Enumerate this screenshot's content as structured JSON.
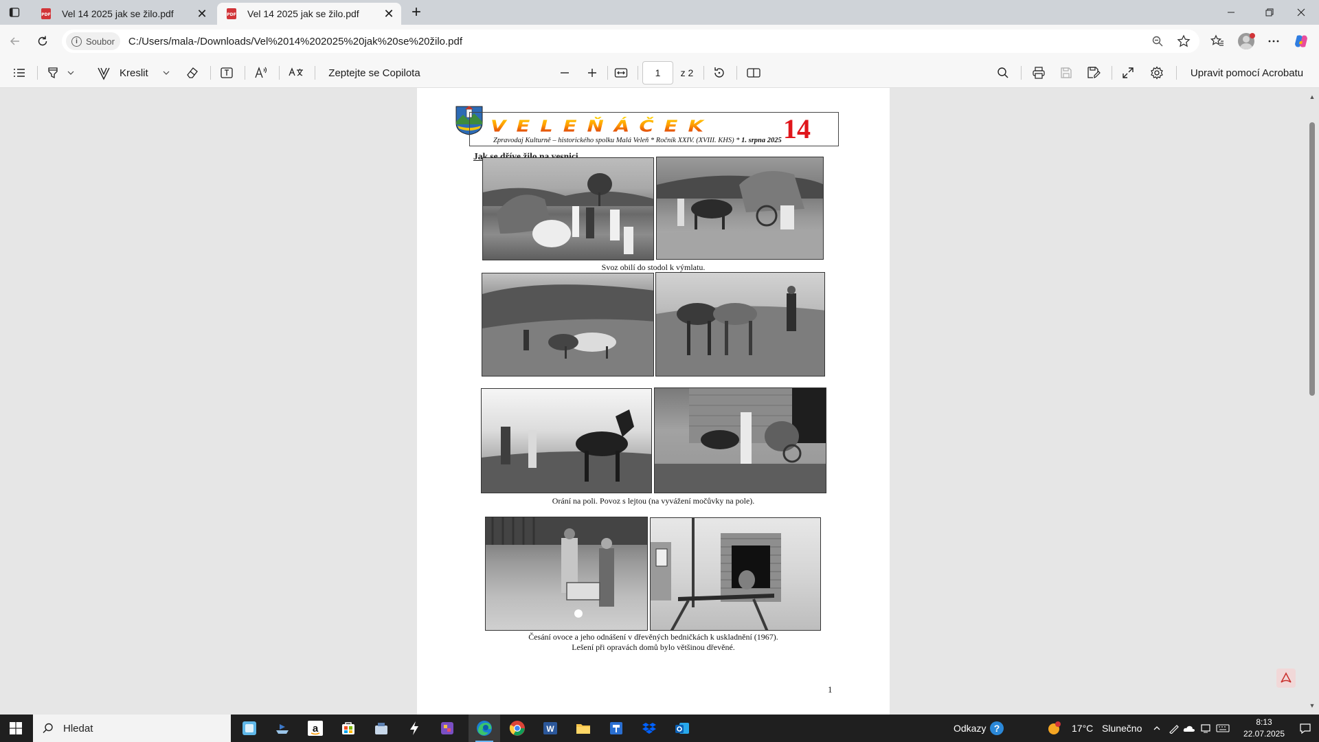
{
  "browser": {
    "tabs": [
      {
        "title": "Vel 14 2025 jak se žilo.pdf",
        "active": false
      },
      {
        "title": "Vel 14 2025 jak se žilo.pdf",
        "active": true
      }
    ],
    "new_tab_label": "+",
    "site_info_label": "Soubor",
    "url": "C:/Users/mala-/Downloads/Vel%2014%202025%20jak%20se%20žilo.pdf"
  },
  "pdf_toolbar": {
    "draw_label": "Kreslit",
    "copilot_label": "Zeptejte se Copilota",
    "page_current": "1",
    "page_total": "z 2",
    "acrobat_label": "Upravit pomocí Acrobatu"
  },
  "document": {
    "masthead_title": "VELEŇÁČEK",
    "masthead_number": "14",
    "masthead_subtitle": "Zpravodaj Kulturně – historického spolku Malá Veleň * Ročník XXIV. (XVIII. KHS) *",
    "masthead_date": "1. srpna 2025",
    "article_title": "Jak se dříve žilo na vesnici",
    "captions": [
      "Svoz obilí do stodol k výmlatu.",
      "Orání na poli. Povoz s lejtou (na vyvážení močůvky na pole).",
      "Česání ovoce a jeho odnášení v dřevěných bedničkách k uskladnění (1967).",
      "Lešení při opravách domů bylo většinou dřevěné."
    ],
    "page_number": "1"
  },
  "taskbar": {
    "search_placeholder": "Hledat",
    "links_label": "Odkazy",
    "weather_temp": "17°C",
    "weather_text": "Slunečno",
    "time": "8:13",
    "date": "22.07.2025"
  },
  "colors": {
    "accent": "#0078d4",
    "pdf_red": "#d13438",
    "masthead_red": "#e0161b",
    "masthead_yellow": "#ffd400"
  }
}
